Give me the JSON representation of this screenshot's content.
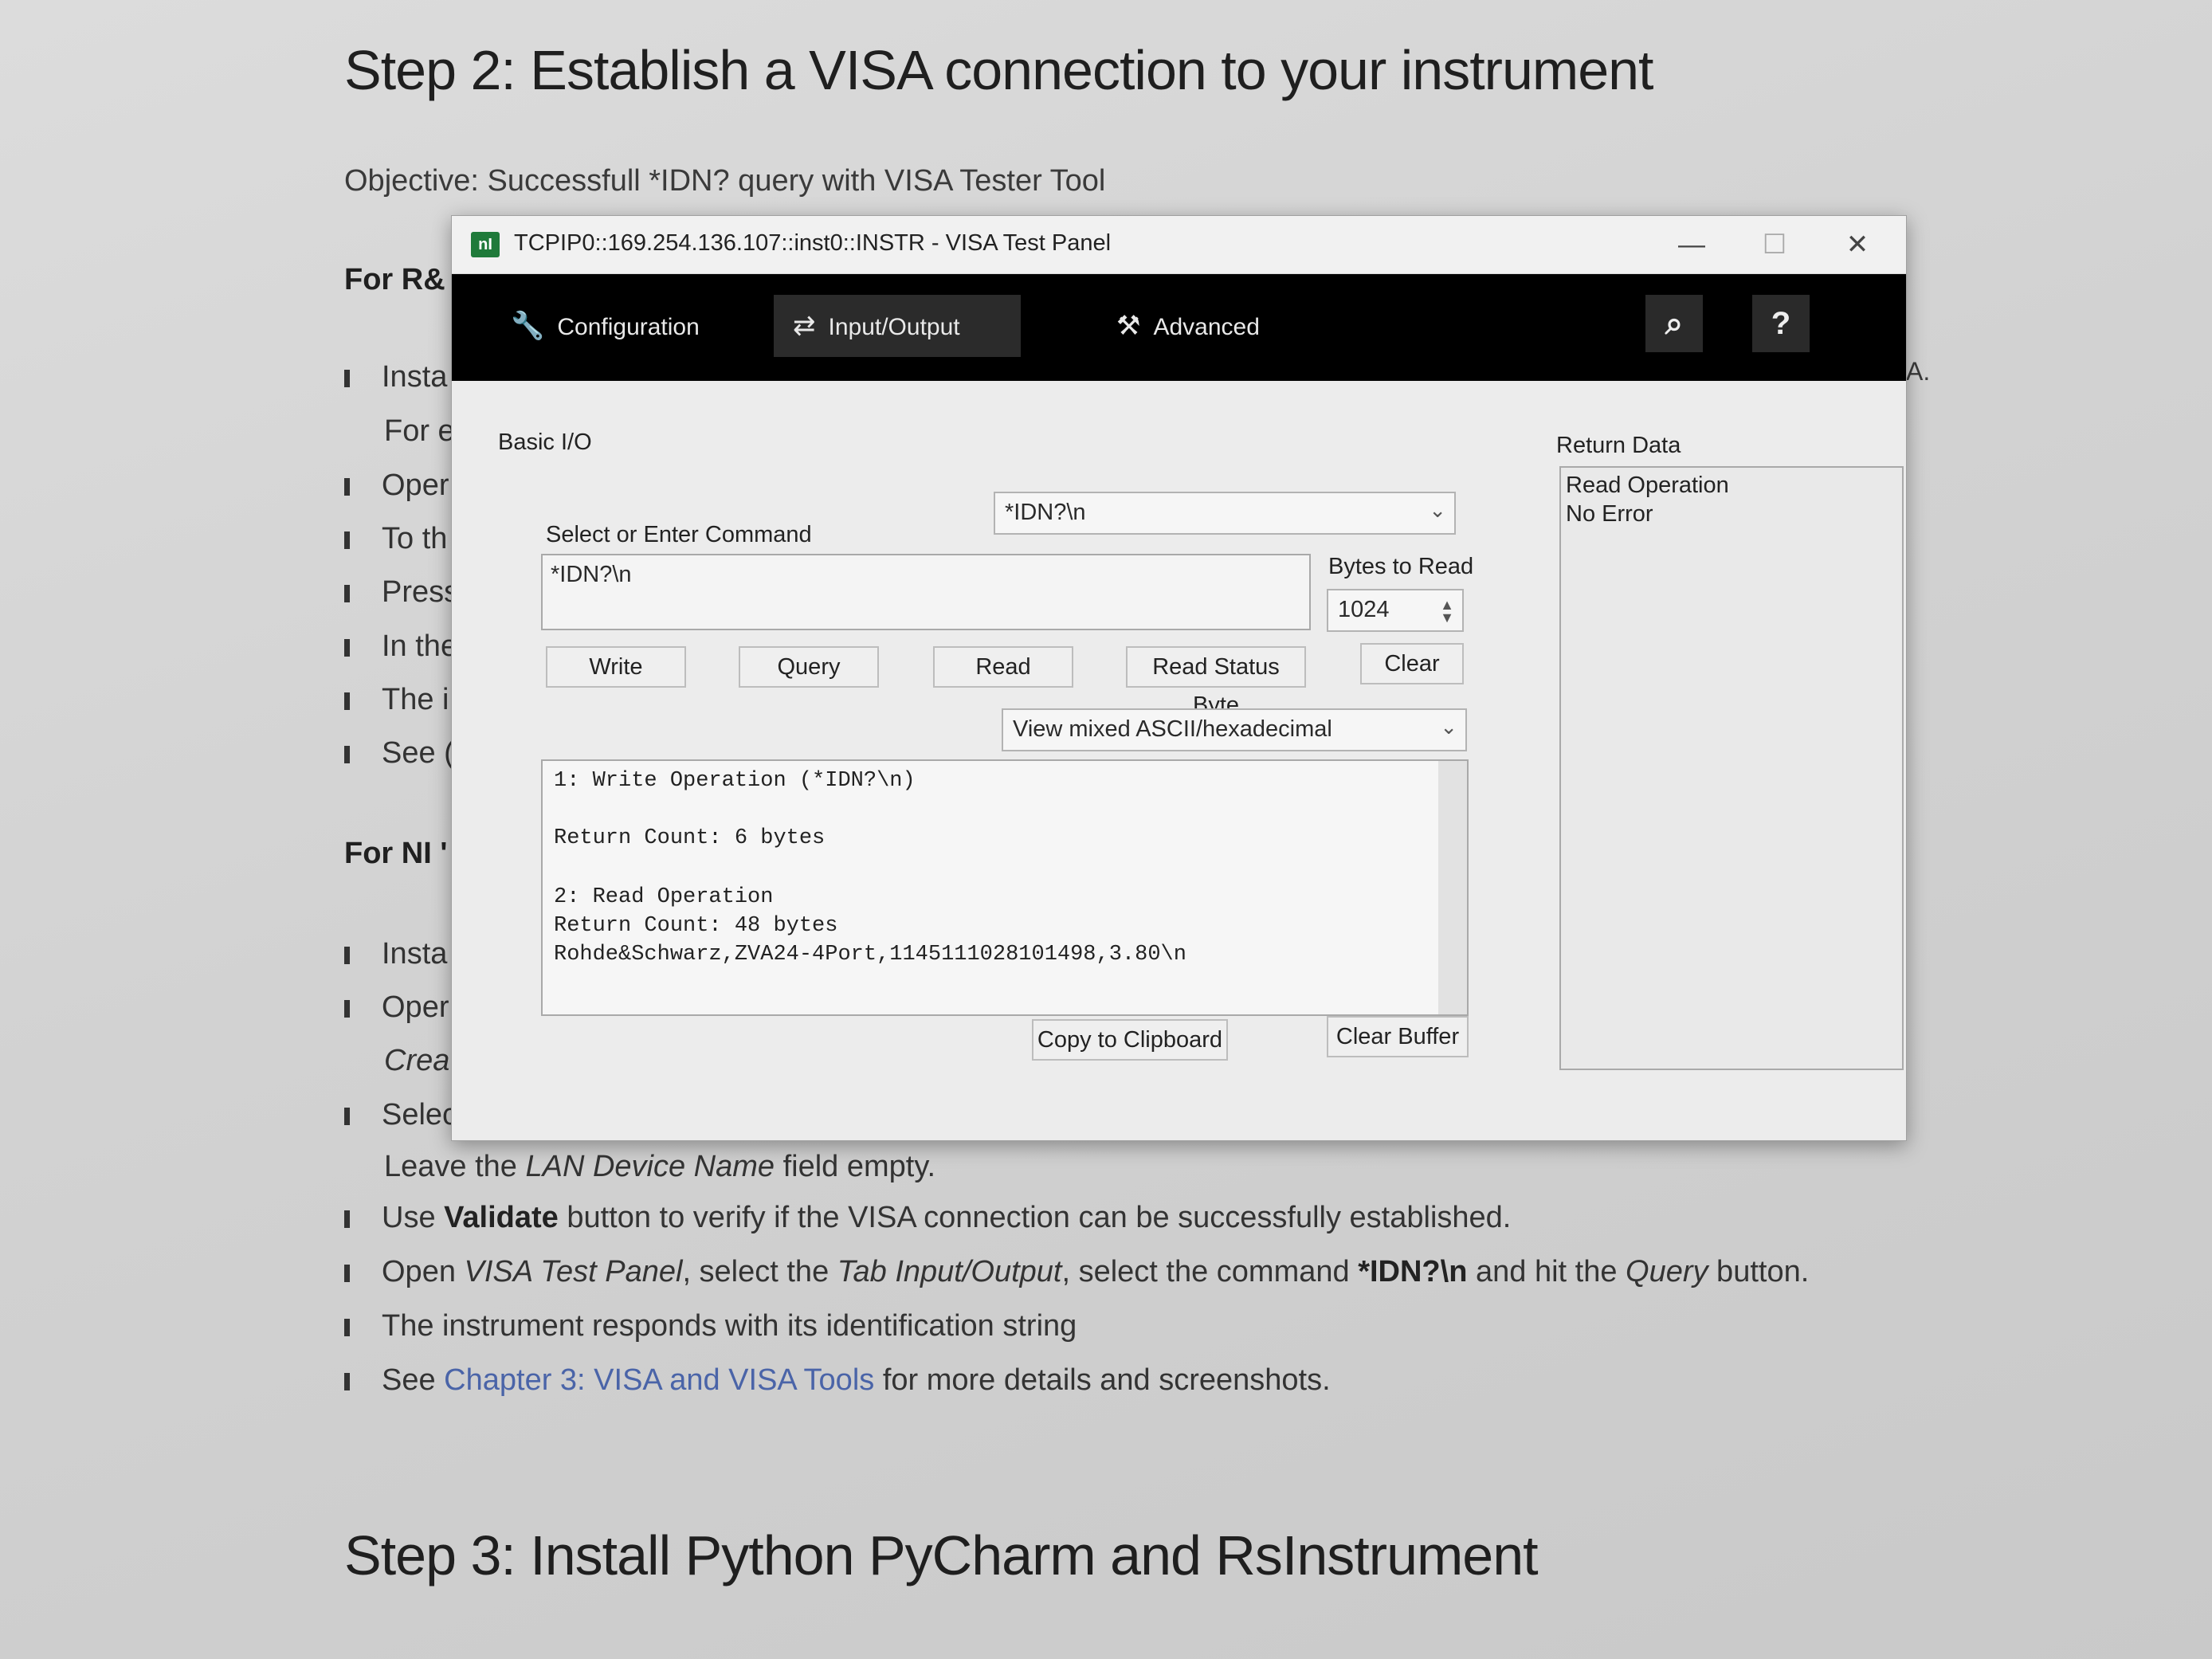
{
  "doc": {
    "step2_title": "Step 2: Establish a VISA connection to your instrument",
    "objective": "Objective: Successfull *IDN? query with VISA Tester Tool",
    "for_rs": "For R&",
    "rs_bullets": [
      "Insta",
      "Oper",
      "To th",
      "Press",
      "In the",
      "The i",
      "See ("
    ],
    "rs_indent": "For e",
    "for_ni": "For NI '",
    "ni_bullets": [
      "Insta",
      "Oper"
    ],
    "ni_indent": "Crea",
    "ni_select": "Selec",
    "leave_pre": "Leave the ",
    "leave_em": "LAN Device Name",
    "leave_post": " field empty.",
    "validate_pre": "Use ",
    "validate_b": "Validate",
    "validate_post": " button to verify if the VISA connection can be successfully established.",
    "open_1": "Open ",
    "open_2": "VISA Test Panel",
    "open_3": ", select the ",
    "open_4": "Tab Input/Output",
    "open_5": ", select the command ",
    "open_6": "*IDN?\\n",
    "open_7": " and hit the ",
    "open_8": "Query",
    "open_9": " button.",
    "responds": "The instrument responds with its identification string",
    "see_pre": "See ",
    "see_link": "Chapter 3: VISA and VISA Tools",
    "see_post": " for more details and screenshots.",
    "stray_a": "A.",
    "step3_title": "Step 3: Install Python PyCharm and RsInstrument"
  },
  "window": {
    "title": "TCPIP0::169.254.136.107::inst0::INSTR - VISA Test Panel",
    "app_icon_text": "nI",
    "minimize": "—",
    "maximize": "☐",
    "close": "✕",
    "tabs": [
      {
        "label": "Configuration",
        "icon": "wrench-icon",
        "glyph": "🔧"
      },
      {
        "label": "Input/Output",
        "icon": "arrows-icon",
        "glyph": "⇄"
      },
      {
        "label": "Advanced",
        "icon": "tools-icon",
        "glyph": "⚒"
      }
    ],
    "search_glyph": "⌕",
    "help_glyph": "?"
  },
  "io": {
    "section": "Basic I/O",
    "select_label": "Select or Enter Command",
    "command_combo": "*IDN?\\n",
    "command_text": "*IDN?\\n",
    "bytes_label": "Bytes to Read",
    "bytes_value": "1024",
    "buttons": [
      "Write",
      "Query",
      "Read",
      "Read Status Byte",
      "Clear"
    ],
    "view_mode": "View mixed ASCII/hexadecimal",
    "output_lines": [
      "1: Write Operation (*IDN?\\n)",
      "",
      "Return Count: 6 bytes",
      "",
      "2: Read Operation",
      "Return Count: 48 bytes",
      "Rohde&Schwarz,ZVA24-4Port,1145111028101498,3.80\\n"
    ],
    "copy_button": "Copy to Clipboard",
    "clear_buffer_button": "Clear Buffer",
    "return_label": "Return Data",
    "return_lines": [
      "Read Operation",
      "No Error"
    ]
  }
}
